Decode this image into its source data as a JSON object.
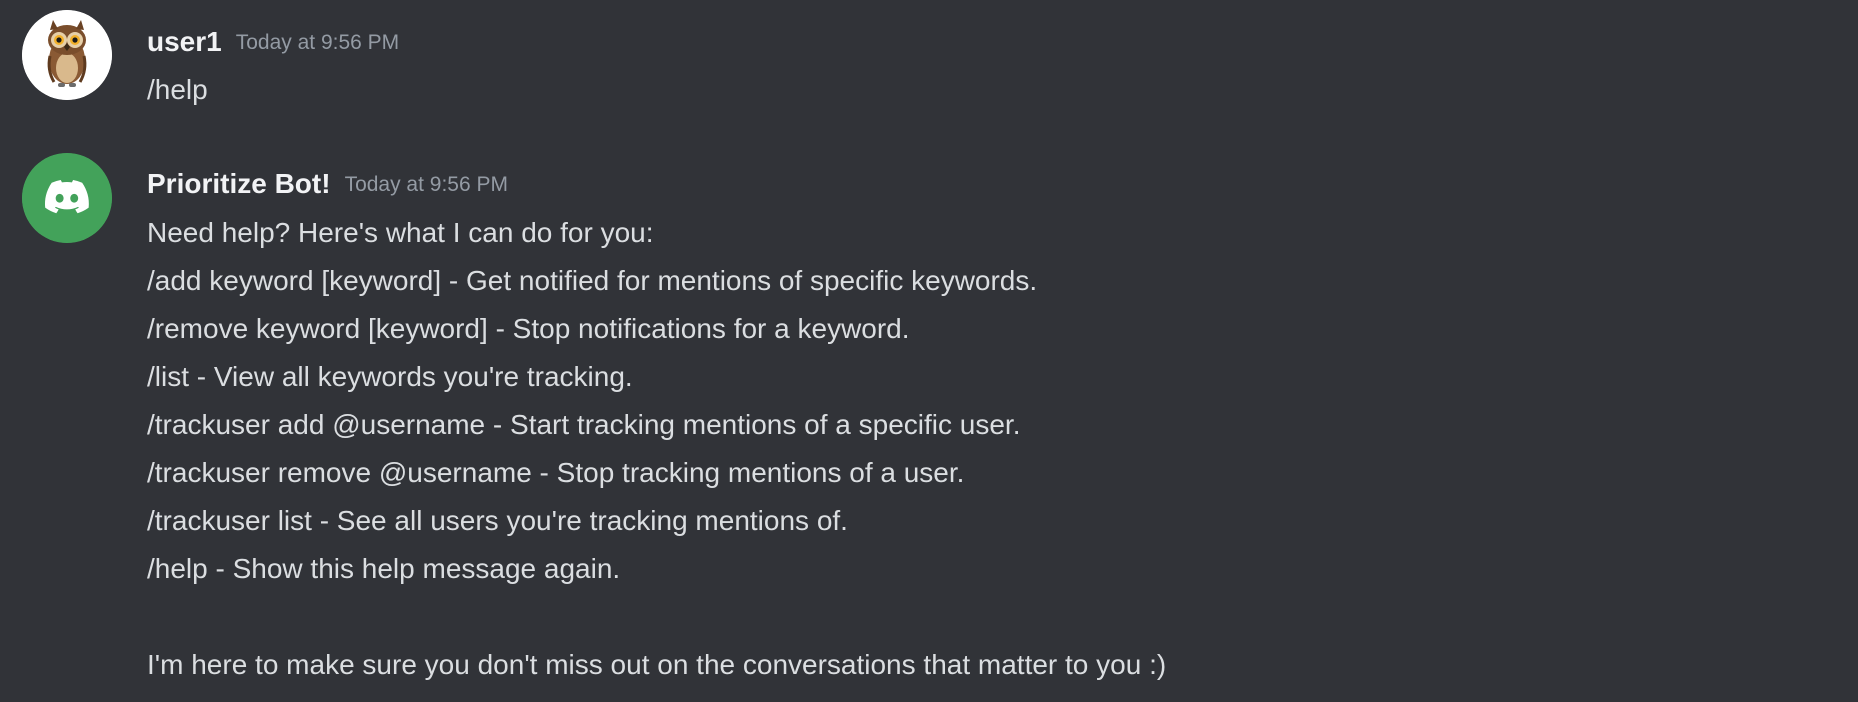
{
  "messages": [
    {
      "author": "user1",
      "timestamp": "Today at 9:56 PM",
      "avatar_icon": "owl-avatar-icon",
      "lines": [
        "/help"
      ]
    },
    {
      "author": "Prioritize Bot!",
      "timestamp": "Today at 9:56 PM",
      "avatar_icon": "discord-logo-icon",
      "avatar_color": "#43a25a",
      "lines": [
        "Need help? Here's what I can do for you:",
        "/add keyword [keyword] - Get notified for mentions of specific keywords.",
        "/remove keyword [keyword] - Stop notifications for a keyword.",
        "/list - View all keywords you're tracking.",
        "/trackuser add @username - Start tracking mentions of a specific user.",
        "/trackuser remove @username - Stop tracking mentions of a user.",
        "/trackuser list - See all users you're tracking mentions of.",
        "/help - Show this help message again.",
        "",
        "I'm here to make sure you don't miss out on the conversations that matter to you :)"
      ]
    }
  ],
  "colors": {
    "background": "#313338",
    "text": "#dbdee1",
    "username": "#f2f3f5",
    "timestamp": "#949ba4",
    "bot_avatar": "#43a25a"
  }
}
